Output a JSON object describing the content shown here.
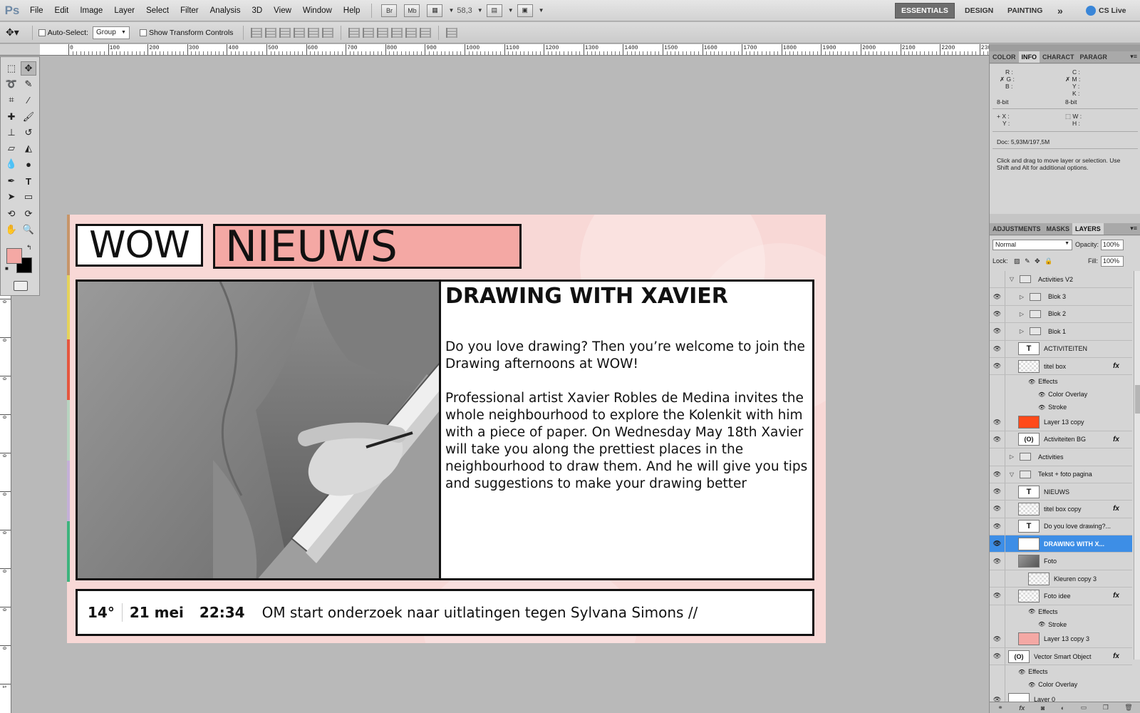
{
  "app": {
    "logo": "Ps"
  },
  "menu": [
    "File",
    "Edit",
    "Image",
    "Layer",
    "Select",
    "Filter",
    "Analysis",
    "3D",
    "View",
    "Window",
    "Help"
  ],
  "menubar_tools": {
    "br_label": "Br",
    "mb_label": "Mb",
    "zoom": "58,3"
  },
  "workspaces": [
    "ESSENTIALS",
    "DESIGN",
    "PAINTING"
  ],
  "workspace_more": "»",
  "cs_live": "CS Live",
  "options": {
    "auto_select_label": "Auto-Select:",
    "auto_select_value": "Group",
    "transform_label": "Show Transform Controls"
  },
  "ruler": {
    "h_labels": [
      "0",
      "100",
      "200",
      "300",
      "400",
      "500",
      "600",
      "700",
      "800",
      "900",
      "1000",
      "1100",
      "1200",
      "1300",
      "1400",
      "1500",
      "1600",
      "1700",
      "1800",
      "1900",
      "2000",
      "2100",
      "2200",
      "230"
    ],
    "v_labels": [
      "0",
      "0",
      "0",
      "0",
      "0",
      "0",
      "0",
      "0",
      "0",
      "0",
      "1",
      "1"
    ]
  },
  "document": {
    "logo_wow": "WOW",
    "logo_nieuws": "NIEUWS",
    "headline": "DRAWING WITH XAVIER",
    "paragraph1": "Do you love drawing? Then you’re welcome to join the Drawing afternoons at WOW!",
    "paragraph2": "Professional artist Xavier Robles de Medina invites the whole neighbourhood to explore the Kolenkit with him with a piece of paper. On Wednesday May 18th Xavier will take you along the prettiest places in the neighbourhood to draw them. And he will give you tips and suggestions to make your drawing better",
    "ticker": {
      "temperature": "14°",
      "date": "21 mei",
      "time": "22:34",
      "text": "OM start onderzoek naar uitlatingen tegen Sylvana Simons //"
    }
  },
  "info_panel": {
    "tabs": [
      "COLOR",
      "INFO",
      "CHARACT",
      "PARAGR"
    ],
    "r": "R :",
    "g": "G :",
    "b": "B :",
    "c": "C :",
    "m": "M :",
    "y": "Y :",
    "k": "K :",
    "bit1": "8-bit",
    "bit2": "8-bit",
    "x": "X :",
    "yy": "Y :",
    "w": "W :",
    "h": "H :",
    "doc": "Doc: 5,93M/197,5M",
    "hint": "Click and drag to move layer or selection. Use Shift and Alt for additional options."
  },
  "layers_panel": {
    "tabs": [
      "ADJUSTMENTS",
      "MASKS",
      "LAYERS"
    ],
    "blend": "Normal",
    "opacity_label": "Opacity:",
    "opacity": "100%",
    "lock_label": "Lock:",
    "fill_label": "Fill:",
    "fill": "100%",
    "fx_label": "fx",
    "layers": [
      {
        "name": "Activities V2",
        "kind": "folder",
        "open": true,
        "indent": 0
      },
      {
        "name": "Blok 3",
        "kind": "folder",
        "open": false,
        "indent": 1
      },
      {
        "name": "Blok 2",
        "kind": "folder",
        "open": false,
        "indent": 1
      },
      {
        "name": "Blok 1",
        "kind": "folder",
        "open": false,
        "indent": 1
      },
      {
        "name": "ACTIVITEITEN",
        "kind": "text",
        "indent": 1
      },
      {
        "name": "titel box",
        "kind": "checker",
        "fx": true,
        "indent": 1
      },
      {
        "name": "Effects",
        "kind": "effects",
        "indent": 2
      },
      {
        "name": "Color Overlay",
        "kind": "effect",
        "indent": 3
      },
      {
        "name": "Stroke",
        "kind": "effect",
        "indent": 3
      },
      {
        "name": "Layer 13 copy",
        "kind": "color",
        "swatch": "#ff4a1a",
        "indent": 1
      },
      {
        "name": "Activiteiten BG",
        "kind": "smart",
        "fx": true,
        "indent": 1
      },
      {
        "name": "Activities",
        "kind": "folder",
        "open": false,
        "indent": 0
      },
      {
        "name": "Tekst + foto pagina",
        "kind": "folder",
        "open": true,
        "indent": 0
      },
      {
        "name": "NIEUWS",
        "kind": "text",
        "indent": 1
      },
      {
        "name": "titel box copy",
        "kind": "checker",
        "fx": true,
        "indent": 1
      },
      {
        "name": "Do you love drawing?...",
        "kind": "text",
        "indent": 1
      },
      {
        "name": "DRAWING WITH X...",
        "kind": "text",
        "indent": 1,
        "selected": true
      },
      {
        "name": "Foto",
        "kind": "photo",
        "indent": 1
      },
      {
        "name": "Kleuren copy 3",
        "kind": "checker",
        "indent": 2
      },
      {
        "name": "Foto idee",
        "kind": "checker",
        "fx": true,
        "indent": 1
      },
      {
        "name": "Effects",
        "kind": "effects",
        "indent": 2
      },
      {
        "name": "Stroke",
        "kind": "effect",
        "indent": 3
      },
      {
        "name": "Layer 13 copy 3",
        "kind": "color",
        "swatch": "#f4a8a4",
        "indent": 1
      },
      {
        "name": "Vector Smart Object",
        "kind": "smart",
        "fx": true,
        "indent": 0
      },
      {
        "name": "Effects",
        "kind": "effects",
        "indent": 1
      },
      {
        "name": "Color Overlay",
        "kind": "effect",
        "indent": 2
      },
      {
        "name": "Layer 0",
        "kind": "white",
        "indent": 0
      }
    ]
  },
  "colors": {
    "accent_pink": "#f4a8a4",
    "doc_bg": "#f8d8d6",
    "selected_layer": "#3d8ee6"
  }
}
